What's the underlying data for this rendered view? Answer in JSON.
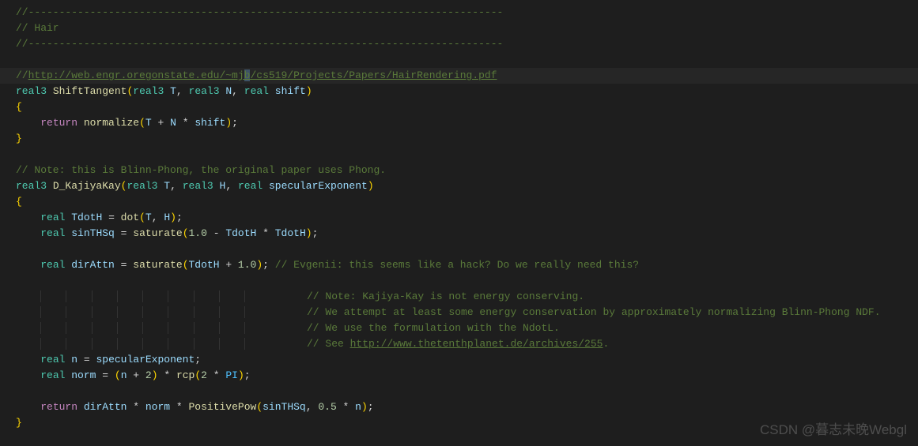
{
  "code": {
    "l1": "//-----------------------------------------------------------------------------",
    "l2": "// Hair",
    "l3": "//-----------------------------------------------------------------------------",
    "l4_prefix": "//",
    "l4_url_a": "http://web.engr.oregonstate.edu/~mj",
    "l4_url_sel": "b",
    "l4_url_b": "/cs519/Projects/Papers/HairRendering.pdf",
    "type_real3": "real3",
    "type_real": "real",
    "fn_shift": "ShiftTangent",
    "param_T": "T",
    "param_N": "N",
    "param_H": "H",
    "param_shift": "shift",
    "param_specExp": "specularExponent",
    "kw_return": "return",
    "fn_normalize": "normalize",
    "op_plus": " + ",
    "op_mul": " * ",
    "op_minus": " - ",
    "op_eq": " = ",
    "semi": ";",
    "comma": ", ",
    "l9": "// Note: this is Blinn-Phong, the original paper uses Phong.",
    "fn_kajiya": "D_KajiyaKay",
    "var_tdoth": "TdotH",
    "fn_dot": "dot",
    "var_sinthsq": "sinTHSq",
    "fn_saturate": "saturate",
    "num_1p0": "1.0",
    "var_dirattn": "dirAttn",
    "l17c": "// Evgenii: this seems like a hack? Do we really need this?",
    "l18": "// Note: Kajiya-Kay is not energy conserving.",
    "l19": "// We attempt at least some energy conservation by approximately normalizing Blinn-Phong NDF.",
    "l20": "// We use the formulation with the NdotL.",
    "l21a": "// See ",
    "l21b": "http://www.thetenthplanet.de/archives/255",
    "l21c": ".",
    "var_n": "n",
    "var_norm": "norm",
    "num_2": "2",
    "fn_rcp": "rcp",
    "const_pi": "PI",
    "fn_pospow": "PositivePow",
    "num_0p5": "0.5"
  },
  "watermark": "CSDN @暮志未晚Webgl"
}
